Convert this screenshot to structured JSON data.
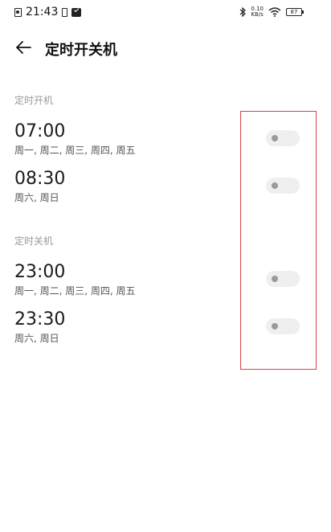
{
  "status_bar": {
    "time": "21:43",
    "speed_top": "0.10",
    "speed_bottom": "KB/s",
    "battery": "87",
    "icons": [
      "sd-card-icon",
      "phone-icon",
      "message-icon",
      "bluetooth-icon",
      "wifi-icon",
      "battery-icon"
    ]
  },
  "header": {
    "title": "定时开关机",
    "back_icon": "back-arrow-icon"
  },
  "sections": [
    {
      "label": "定时开机",
      "items": [
        {
          "time": "07:00",
          "days": "周一, 周二, 周三, 周四, 周五",
          "enabled": false
        },
        {
          "time": "08:30",
          "days": "周六, 周日",
          "enabled": false
        }
      ]
    },
    {
      "label": "定时关机",
      "items": [
        {
          "time": "23:00",
          "days": "周一, 周二, 周三, 周四, 周五",
          "enabled": false
        },
        {
          "time": "23:30",
          "days": "周六, 周日",
          "enabled": false
        }
      ]
    }
  ],
  "colors": {
    "highlight_border": "#d94040",
    "toggle_track_off": "#efefef",
    "toggle_knob_off": "#9a9a9a",
    "section_label": "#9a9a9a"
  }
}
